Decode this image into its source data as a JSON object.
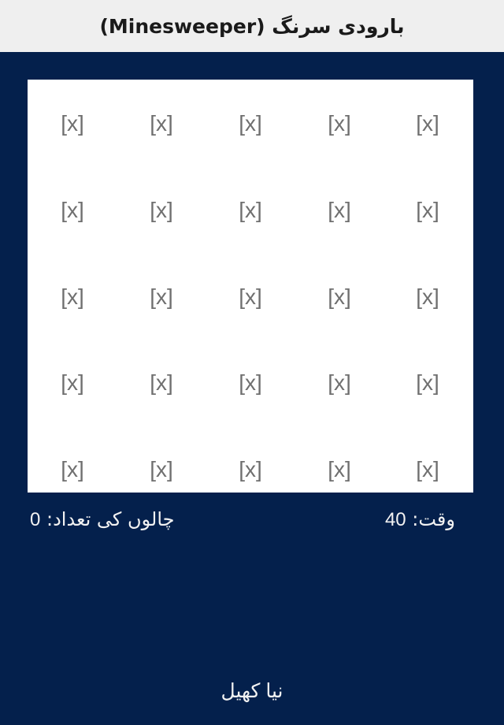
{
  "header": {
    "title": "بارودی سرنگ (Minesweeper)"
  },
  "board": {
    "rows": 5,
    "cols": 5,
    "cells": [
      [
        "[x]",
        "[x]",
        "[x]",
        "[x]",
        "[x]"
      ],
      [
        "[x]",
        "[x]",
        "[x]",
        "[x]",
        "[x]"
      ],
      [
        "[x]",
        "[x]",
        "[x]",
        "[x]",
        "[x]"
      ],
      [
        "[x]",
        "[x]",
        "[x]",
        "[x]",
        "[x]"
      ],
      [
        "[x]",
        "[x]",
        "[x]",
        "[x]",
        "[x]"
      ]
    ]
  },
  "stats": {
    "moves_label": "چالوں کی تعداد:",
    "moves_value": "0",
    "time_label": "وقت:",
    "time_value": "40"
  },
  "footer": {
    "new_game_label": "نیا کھیل"
  },
  "colors": {
    "background": "#04204c",
    "titlebar": "#efefef",
    "board": "#ffffff",
    "cell_text": "#6f6f6f",
    "text_light": "#f2f2f2"
  }
}
